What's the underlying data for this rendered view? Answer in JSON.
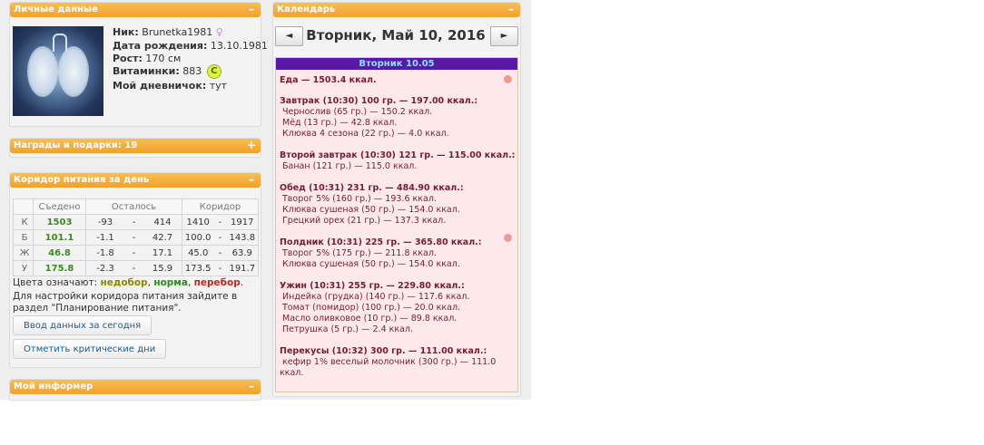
{
  "personal": {
    "header": "Личные данные",
    "toggle": "–",
    "nick_label": "Ник:",
    "nick": "Brunetka1981",
    "gender_icon": "♀",
    "birth_label": "Дата рождения:",
    "birth": "13.10.1981",
    "height_label": "Рост:",
    "height": "170 см",
    "vitamins_label": "Витаминки:",
    "vitamins": "883",
    "vitamin_badge": "C",
    "diary_label": "Мой дневничок:",
    "diary": "тут"
  },
  "awards": {
    "header": "Награды и подарки: 19",
    "toggle": "+"
  },
  "corridor": {
    "header": "Коридор питания за день",
    "toggle": "–",
    "col_eaten": "Съедено",
    "col_left": "Осталось",
    "col_corridor": "Коридор",
    "rows": [
      {
        "label": "К",
        "eaten": "1503",
        "left_min": "-93",
        "left_max": "414",
        "cor_min": "1410",
        "cor_max": "1917"
      },
      {
        "label": "Б",
        "eaten": "101.1",
        "left_min": "-1.1",
        "left_max": "42.7",
        "cor_min": "100.0",
        "cor_max": "143.8"
      },
      {
        "label": "Ж",
        "eaten": "46.8",
        "left_min": "-1.8",
        "left_max": "17.1",
        "cor_min": "45.0",
        "cor_max": "63.9"
      },
      {
        "label": "У",
        "eaten": "175.8",
        "left_min": "-2.3",
        "left_max": "15.9",
        "cor_min": "173.5",
        "cor_max": "191.7"
      }
    ],
    "dash": "-",
    "legend_prefix": "Цвета означают:",
    "legend_under": "недобор",
    "legend_norm": "норма",
    "legend_over": "перебор",
    "legend_colors": {
      "under": "#8a8a00",
      "norm": "#2e8b1c",
      "over": "#c0271c"
    },
    "note_line1": "Для настройки коридора питания зайдите в",
    "note_line2": "раздел \"Планирование питания\".",
    "btn_today": "Ввод данных за сегодня",
    "btn_critical": "Отметить критические дни"
  },
  "informer": {
    "header": "Мой информер",
    "toggle": "–"
  },
  "calendar": {
    "header": "Календарь",
    "toggle": "–",
    "prev": "◄",
    "next": "►",
    "title": "Вторник, Май 10, 2016",
    "day_header": "Вторник 10.05",
    "lines": [
      {
        "text": "Еда — 1503.4 ккал.",
        "bold": true
      },
      {
        "text": "Завтрак (10:30) 100 гр. — 197.00 ккал.:",
        "bold": true
      },
      {
        "text": "Чернослив (65 гр.) — 150.2 ккал."
      },
      {
        "text": "Мёд (13 гр.) — 42.8 ккал."
      },
      {
        "text": "Клюква 4 сезона (22 гр.) — 4.0 ккал."
      },
      {
        "text": "Второй завтрак (10:30) 121 гр. — 115.00 ккал.:",
        "bold": true
      },
      {
        "text": "Банан (121 гр.) — 115.0 ккал."
      },
      {
        "text": "Обед (10:31) 231 гр. — 484.90 ккал.:",
        "bold": true
      },
      {
        "text": "Творог 5% (160 гр.) — 193.6 ккал."
      },
      {
        "text": "Клюква сушеная (50 гр.) — 154.0 ккал."
      },
      {
        "text": "Грецкий орех (21 гр.) — 137.3 ккал."
      },
      {
        "text": "Полдник (10:31) 225 гр. — 365.80 ккал.:",
        "bold": true
      },
      {
        "text": "Творог 5% (175 гр.) — 211.8 ккал."
      },
      {
        "text": "Клюква сушеная (50 гр.) — 154.0 ккал."
      },
      {
        "text": "Ужин (10:31) 255 гр. — 229.80 ккал.:",
        "bold": true
      },
      {
        "text": "Индейка (грудка) (140 гр.) — 117.6 ккал."
      },
      {
        "text": "Томат (помидор) (100 гр.) — 20.0 ккал."
      },
      {
        "text": "Масло оливковое (10 гр.) — 89.8 ккал."
      },
      {
        "text": "Петрушка (5 гр.) — 2.4 ккал."
      },
      {
        "text": "Перекусы (10:32) 300 гр. — 111.00 ккал.:",
        "bold": true
      },
      {
        "text": "кефир 1% веселый молочник (300 гр.) — 111.0"
      },
      {
        "text": "ккал."
      }
    ]
  }
}
